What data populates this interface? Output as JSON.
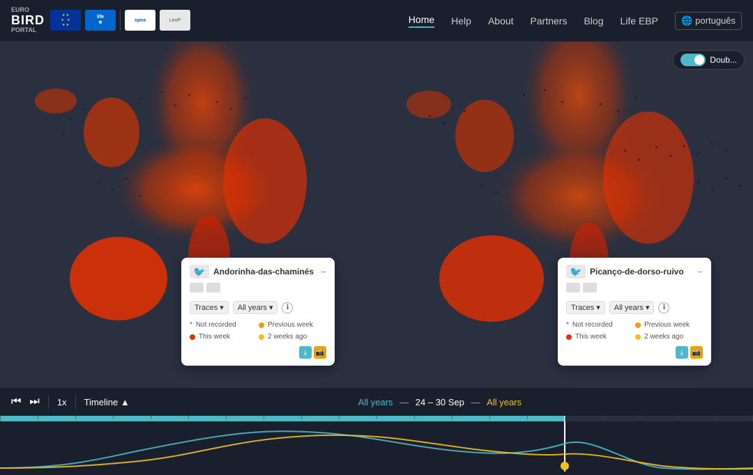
{
  "header": {
    "logo": {
      "line1": "EURO",
      "line2": "BIRD",
      "line3": "PORTAL"
    },
    "nav": [
      {
        "id": "home",
        "label": "Home",
        "active": true
      },
      {
        "id": "help",
        "label": "Help",
        "active": false
      },
      {
        "id": "about",
        "label": "About",
        "active": false
      },
      {
        "id": "partners",
        "label": "Partners",
        "active": false
      },
      {
        "id": "blog",
        "label": "Blog",
        "active": false
      },
      {
        "id": "life-ebp",
        "label": "Life EBP",
        "active": false
      }
    ],
    "language": "português",
    "double_toggle_label": "Doub..."
  },
  "cards": {
    "left": {
      "title": "Andorinha-das-chaminés",
      "filter1": "Traces",
      "filter2": "All years",
      "legend": [
        {
          "type": "asterisk",
          "color": "#999",
          "label": "Not recorded"
        },
        {
          "type": "dot",
          "color": "#f0a000",
          "label": "Previous week"
        },
        {
          "type": "dot",
          "color": "#e63000",
          "label": "This week"
        },
        {
          "type": "dot",
          "color": "#f0c020",
          "label": "2 weeks ago"
        }
      ]
    },
    "right": {
      "title": "Picanço-de-dorso-ruivo",
      "filter1": "Traces",
      "filter2": "All years",
      "legend": [
        {
          "type": "asterisk",
          "color": "#999",
          "label": "Not recorded"
        },
        {
          "type": "dot",
          "color": "#f0a000",
          "label": "Previous week"
        },
        {
          "type": "dot",
          "color": "#e63000",
          "label": "This week"
        },
        {
          "type": "dot",
          "color": "#f0c020",
          "label": "2 weeks ago"
        }
      ]
    }
  },
  "timeline": {
    "speed": "1x",
    "mode": "Timeline",
    "label_parts": {
      "all_years_left": "All years",
      "separator": "—",
      "date_range": "24 – 30 Sep",
      "separator2": "—",
      "all_years_right": "All years"
    },
    "play_icon": "⏮",
    "next_icon": "⏭"
  }
}
